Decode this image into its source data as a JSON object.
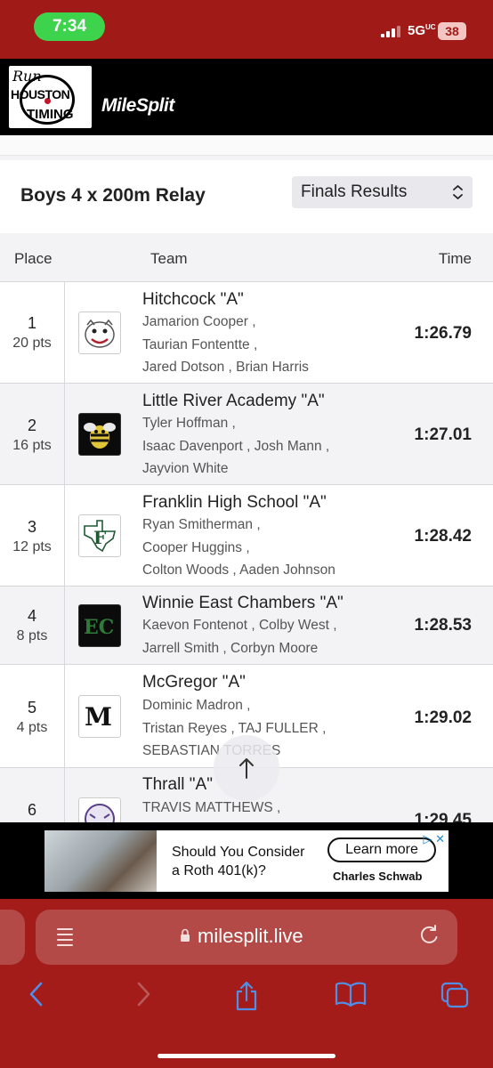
{
  "status": {
    "time": "7:34",
    "network": "5G",
    "network_suffix": "UC",
    "battery": "38"
  },
  "header": {
    "logo_run": "Run",
    "logo_houston": "HOUSTON",
    "logo_timing": "TIMING",
    "brand": "MileSplit"
  },
  "event": {
    "title": "Boys 4 x 200m Relay",
    "view_selected": "Finals Results"
  },
  "table": {
    "headers": {
      "place": "Place",
      "team": "Team",
      "time": "Time"
    },
    "rows": [
      {
        "place": "1",
        "pts": "20 pts",
        "team": "Hitchcock \"A\"",
        "lines": [
          "Jamarion Cooper ,",
          "Taurian Fontentte ,",
          "Jared Dotson , Brian Harris"
        ],
        "time": "1:26.79"
      },
      {
        "place": "2",
        "pts": "16 pts",
        "team": "Little River Academy \"A\"",
        "lines": [
          "Tyler Hoffman ,",
          "Isaac Davenport , Josh Mann ,",
          "Jayvion White"
        ],
        "time": "1:27.01"
      },
      {
        "place": "3",
        "pts": "12 pts",
        "team": "Franklin High School \"A\"",
        "lines": [
          "Ryan Smitherman ,",
          "Cooper Huggins ,",
          "Colton Woods , Aaden Johnson"
        ],
        "time": "1:28.42"
      },
      {
        "place": "4",
        "pts": "8 pts",
        "team": "Winnie East Chambers \"A\"",
        "lines": [
          "Kaevon Fontenot , Colby West ,",
          "Jarrell Smith , Corbyn Moore"
        ],
        "time": "1:28.53"
      },
      {
        "place": "5",
        "pts": "4 pts",
        "team": "McGregor \"A\"",
        "lines": [
          "Dominic Madron ,",
          "Tristan Reyes , TAJ FULLER ,",
          "SEBASTIAN TORRES"
        ],
        "time": "1:29.02"
      },
      {
        "place": "6",
        "pts": "",
        "team": "Thrall \"A\"",
        "lines": [
          "TRAVIS MATTHEWS ,"
        ],
        "time": "1:29.45"
      }
    ]
  },
  "logo_letters": {
    "franklin": "F",
    "winnie": "EC",
    "mcgregor": "M"
  },
  "ad": {
    "headline_1": "Should You Consider",
    "headline_2": "a Roth 401(k)?",
    "cta": "Learn more",
    "brand": "Charles Schwab"
  },
  "browser": {
    "url": "milesplit.live"
  },
  "icons": {
    "scroll_top": "arrow-up-icon",
    "reader": "reader-icon",
    "lock": "lock-icon",
    "reload": "reload-icon",
    "back": "back-chevron-icon",
    "forward": "forward-chevron-icon",
    "share": "share-icon",
    "bookmarks": "book-icon",
    "tabs": "tabs-icon"
  },
  "colors": {
    "status_bar": "#a01a17",
    "browser_chrome": "#a41c1a",
    "accent_blue": "#4f8fe8"
  }
}
